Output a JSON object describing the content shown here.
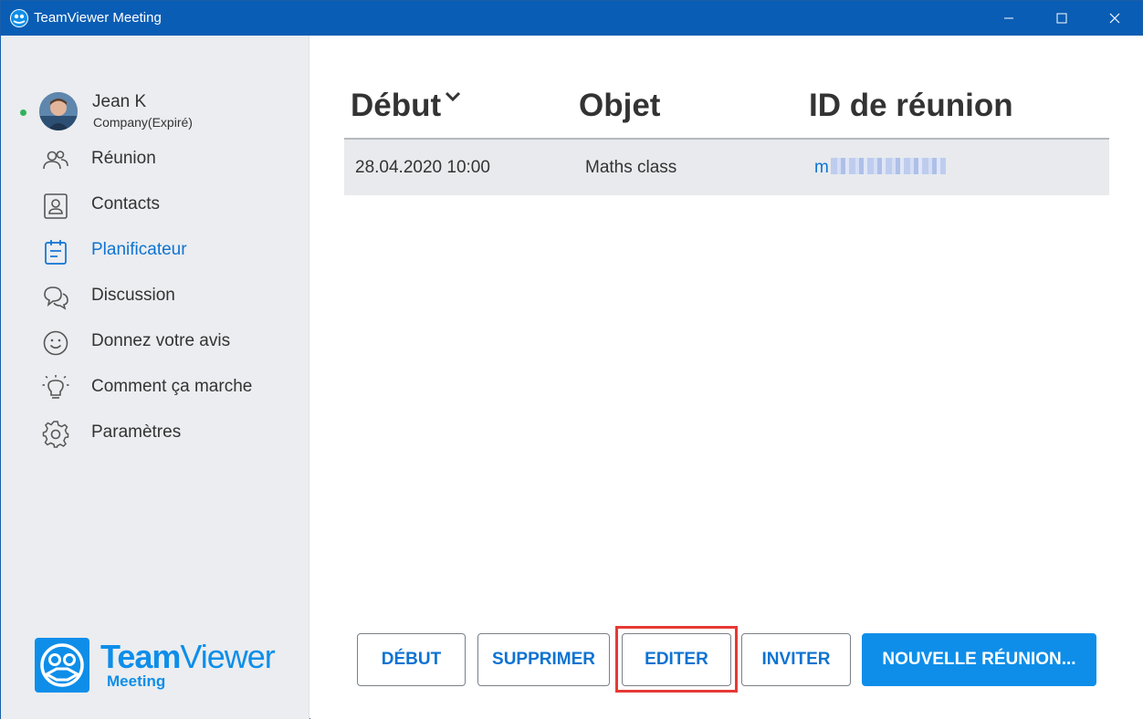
{
  "window": {
    "title": "TeamViewer Meeting"
  },
  "user": {
    "name": "Jean K",
    "company": "Company(Expiré)"
  },
  "nav": {
    "items": [
      {
        "label": "Réunion",
        "icon": "users-icon"
      },
      {
        "label": "Contacts",
        "icon": "contact-card-icon"
      },
      {
        "label": "Planificateur",
        "icon": "calendar-icon",
        "active": true
      },
      {
        "label": "Discussion",
        "icon": "chat-icon"
      },
      {
        "label": "Donnez votre avis",
        "icon": "smiley-icon"
      },
      {
        "label": "Comment ça marche",
        "icon": "lightbulb-icon"
      },
      {
        "label": "Paramètres",
        "icon": "gear-icon"
      }
    ]
  },
  "logo": {
    "brand_bold": "Team",
    "brand_light": "Viewer",
    "product": "Meeting"
  },
  "table": {
    "columns": [
      "Début",
      "Objet",
      "ID de réunion"
    ],
    "rows": [
      {
        "date": "28.04.2020 10:00",
        "subject": "Maths class",
        "meeting_id": "m"
      }
    ]
  },
  "buttons": {
    "debut": "DÉBUT",
    "supprimer": "SUPPRIMER",
    "editer": "EDITER",
    "inviter": "INVITER",
    "nouvelle": "NOUVELLE RÉUNION..."
  },
  "colors": {
    "titlebar": "#0a5db4",
    "accent": "#0e8ee9",
    "link": "#0e73d2",
    "highlight": "#e53935",
    "status_online": "#31b35a"
  }
}
